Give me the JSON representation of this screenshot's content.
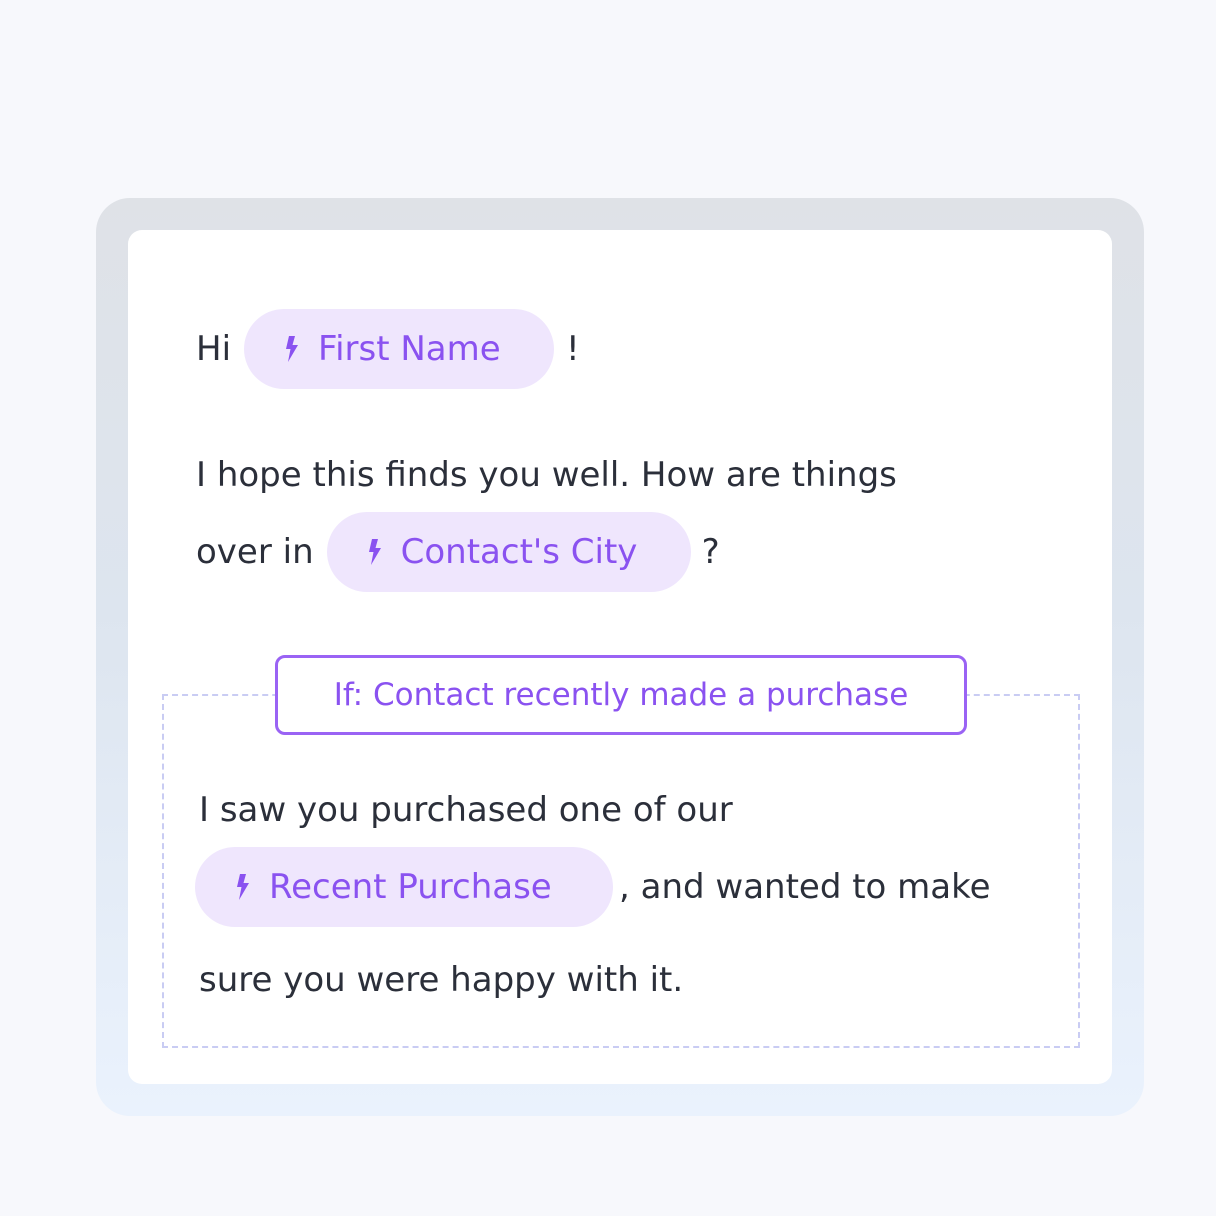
{
  "greeting": {
    "prefix": "Hi",
    "token": "First Name",
    "suffix": "!"
  },
  "paragraph1": {
    "line1": "I hope this finds you well. How are things",
    "line2_prefix": "over in",
    "token": "Contact's City",
    "suffix": "?"
  },
  "condition": {
    "label": "If: Contact recently made a purchase"
  },
  "conditional_paragraph": {
    "line1": "I saw you purchased one of our",
    "token": "Recent Purchase",
    "line2_suffix": ", and wanted to make",
    "line3": "sure you were happy with it."
  },
  "icons": {
    "token_icon": "lightning-bolt-icon"
  },
  "colors": {
    "token_background": "#efe6fd",
    "token_text": "#8a52f0",
    "condition_border": "#9a63f4",
    "dashed_border": "#c9ccf3",
    "body_text": "#2b2f3a"
  }
}
